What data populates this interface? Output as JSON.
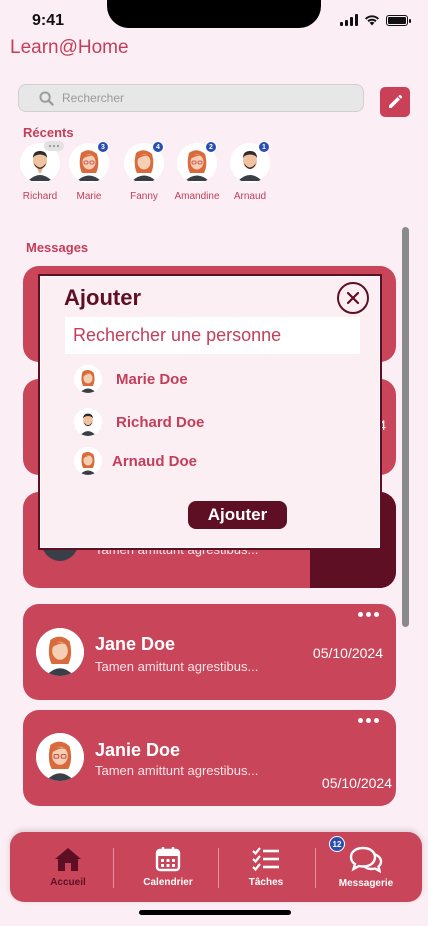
{
  "status": {
    "time": "9:41"
  },
  "app": {
    "title": "Learn@Home"
  },
  "search": {
    "placeholder": "Rechercher"
  },
  "recents": {
    "label": "Récents",
    "items": [
      {
        "name": "Richard",
        "badge": "",
        "typing": true,
        "avatar": "male-avatar"
      },
      {
        "name": "Marie",
        "badge": "3",
        "typing": false,
        "avatar": "female-avatar"
      },
      {
        "name": "Fanny",
        "badge": "4",
        "typing": false,
        "avatar": "female-avatar"
      },
      {
        "name": "Amandine",
        "badge": "2",
        "typing": false,
        "avatar": "female-avatar"
      },
      {
        "name": "Arnaud",
        "badge": "1",
        "typing": false,
        "avatar": "male-avatar"
      }
    ]
  },
  "messages": {
    "label": "Messages",
    "items": [
      {
        "name": "",
        "preview": "Tamen amittunt agrestibus...",
        "date": ""
      },
      {
        "name": "Jane Doe",
        "preview": "Tamen amittunt agrestibus...",
        "date": "05/10/2024"
      },
      {
        "name": "Janie Doe",
        "preview": "Tamen amittunt agrestibus...",
        "date": "05/10/2024"
      }
    ],
    "partial_date": "4"
  },
  "modal": {
    "title": "Ajouter",
    "search_placeholder": "Rechercher une personne",
    "people": [
      {
        "name": "Marie Doe",
        "avatar": "female-avatar"
      },
      {
        "name": "Richard Doe",
        "avatar": "male-avatar"
      },
      {
        "name": "Arnaud Doe",
        "avatar": "female-avatar"
      }
    ],
    "submit_label": "Ajouter"
  },
  "nav": {
    "items": [
      {
        "label": "Accueil",
        "icon": "home-icon",
        "active": true
      },
      {
        "label": "Calendrier",
        "icon": "calendar-icon",
        "active": false
      },
      {
        "label": "Tâches",
        "icon": "tasks-icon",
        "active": false
      },
      {
        "label": "Messagerie",
        "icon": "chat-icon",
        "active": false
      }
    ],
    "messagerie_badge": "12"
  },
  "colors": {
    "accent": "#c8455a",
    "dark": "#5e0f24",
    "background": "#fbeef4",
    "badge": "#2a4fb0"
  }
}
